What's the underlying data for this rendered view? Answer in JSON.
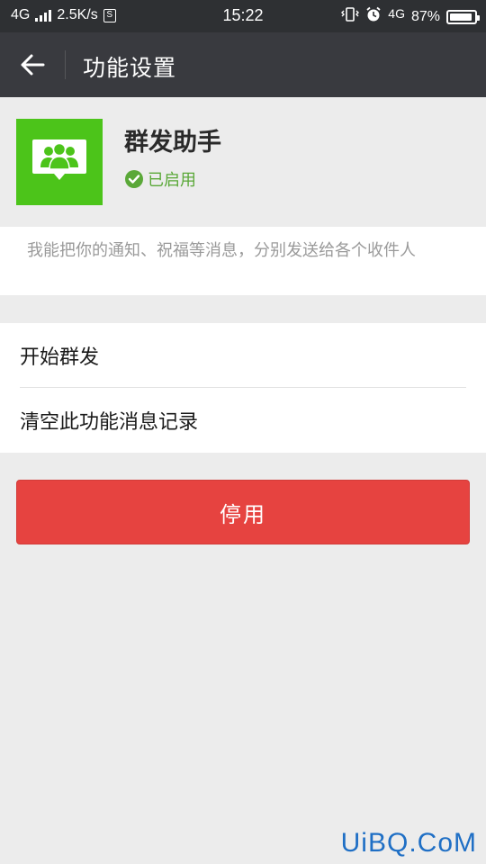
{
  "status_bar": {
    "network_left": "4G",
    "speed": "2.5K/s",
    "sim_label": "S",
    "time": "15:22",
    "network_right": "4G",
    "battery": "87%"
  },
  "nav": {
    "title": "功能设置",
    "back_icon": "arrow-left-icon"
  },
  "feature": {
    "name": "群发助手",
    "status": "已启用",
    "icon": "group-chat-icon",
    "icon_color": "#4cc41a",
    "status_color": "#5aa838"
  },
  "description": "我能把你的通知、祝福等消息，分别发送给各个收件人",
  "menu": {
    "items": [
      {
        "label": "开始群发"
      },
      {
        "label": "清空此功能消息记录"
      }
    ]
  },
  "button": {
    "disable_label": "停用",
    "color": "#e64340"
  },
  "watermark": "UiBQ.CoM"
}
